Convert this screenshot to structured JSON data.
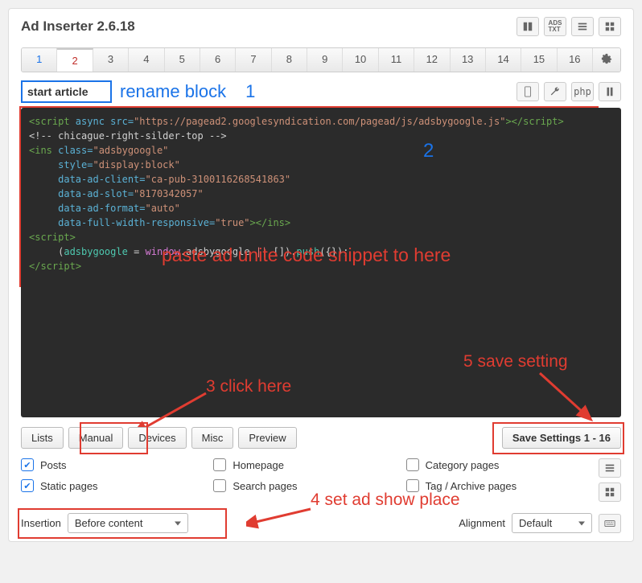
{
  "header": {
    "title": "Ad Inserter 2.6.18"
  },
  "tabs": [
    "1",
    "2",
    "3",
    "4",
    "5",
    "6",
    "7",
    "8",
    "9",
    "10",
    "11",
    "12",
    "13",
    "14",
    "15",
    "16"
  ],
  "active_tab": 1,
  "block_name": "start article",
  "annotations": {
    "rename": "rename block",
    "step1": "1",
    "step2": "2",
    "paste_hint": "paste ad unite code snippet to here",
    "step3": "3 click here",
    "step4": "4 set ad show place",
    "step5": "5 save setting"
  },
  "code": {
    "l1a": "<script",
    "l1b": " async src=",
    "l1c": "\"https://pagead2.googlesyndication.com/pagead/js/adsbygoogle.js\"",
    "l1d": "></",
    "l1e": "script",
    "l1f": ">",
    "l2": "<!-- chicague-right-silder-top -->",
    "l3a": "<ins",
    "l3b": " class=",
    "l3c": "\"adsbygoogle\"",
    "l4a": "     style=",
    "l4b": "\"display:block\"",
    "l5a": "     data-ad-client=",
    "l5b": "\"ca-pub-3100116268541863\"",
    "l6a": "     data-ad-slot=",
    "l6b": "\"8170342057\"",
    "l7a": "     data-ad-format=",
    "l7b": "\"auto\"",
    "l8a": "     data-full-width-responsive=",
    "l8b": "\"true\"",
    "l8c": "></ins>",
    "l9": "<script>",
    "l10a": "     (",
    "l10b": "adsbygoogle",
    "l10c": " = ",
    "l10d": "window",
    "l10e": ".adsbygoogle ",
    "l10f": "||",
    "l10g": " []).",
    "l10h": "push",
    "l10i": "({});",
    "l11a": "</",
    "l11b": "script",
    "l11c": ">"
  },
  "buttons": {
    "lists": "Lists",
    "manual": "Manual",
    "devices": "Devices",
    "misc": "Misc",
    "preview": "Preview",
    "save": "Save Settings 1 - 16",
    "php": "php"
  },
  "checks": {
    "posts": "Posts",
    "static": "Static pages",
    "home": "Homepage",
    "search": "Search pages",
    "category": "Category pages",
    "tag": "Tag / Archive pages"
  },
  "insertion": {
    "label": "Insertion",
    "value": "Before content",
    "align_label": "Alignment",
    "align_value": "Default"
  }
}
